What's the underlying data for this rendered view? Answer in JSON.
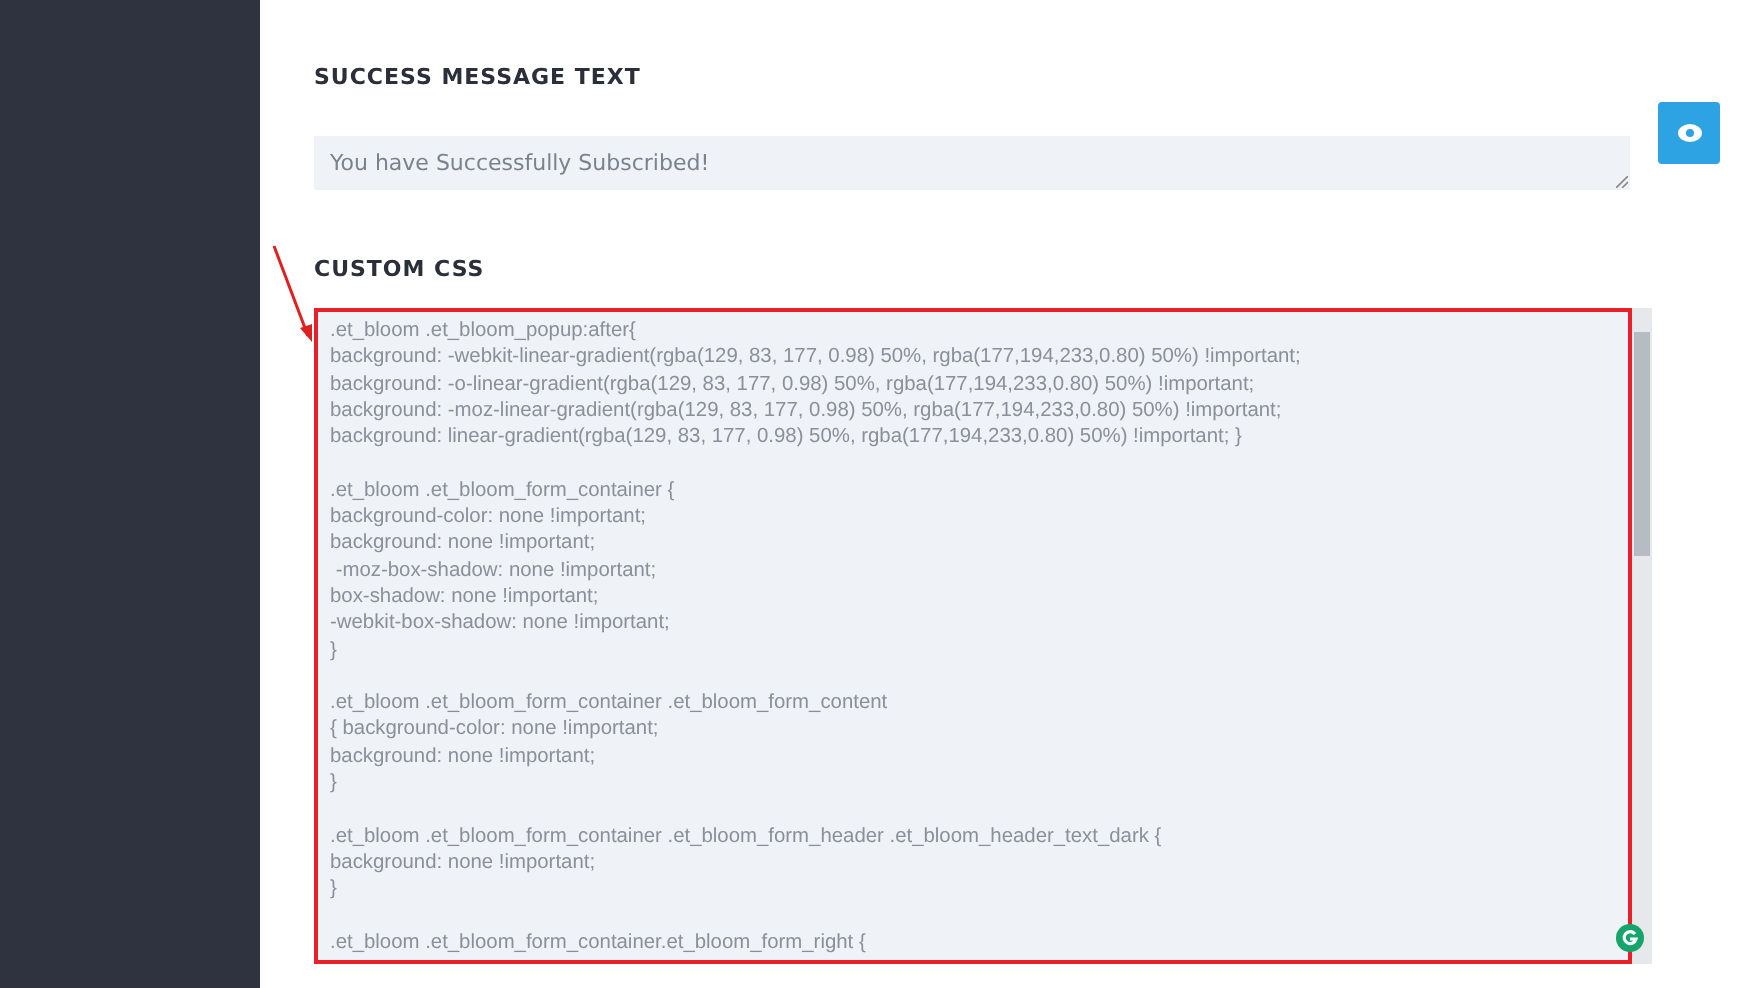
{
  "success_message": {
    "label": "SUCCESS MESSAGE TEXT",
    "value": "You have Successfully Subscribed!"
  },
  "custom_css": {
    "label": "CUSTOM CSS",
    "highlighted": true,
    "code_blocks": [
      [
        ".et_bloom .et_bloom_popup:after{",
        "background: -webkit-linear-gradient(rgba(129, 83, 177, 0.98) 50%, rgba(177,194,233,0.80) 50%) !important;",
        "background: -o-linear-gradient(rgba(129, 83, 177, 0.98) 50%, rgba(177,194,233,0.80) 50%) !important;",
        "background: -moz-linear-gradient(rgba(129, 83, 177, 0.98) 50%, rgba(177,194,233,0.80) 50%) !important;",
        "background: linear-gradient(rgba(129, 83, 177, 0.98) 50%, rgba(177,194,233,0.80) 50%) !important; }"
      ],
      [
        ".et_bloom .et_bloom_form_container {",
        "background-color: none !important;",
        "background: none !important;",
        " -moz-box-shadow: none !important;",
        "box-shadow: none !important;",
        "-webkit-box-shadow: none !important;",
        "}"
      ],
      [
        ".et_bloom .et_bloom_form_container .et_bloom_form_content",
        "{ background-color: none !important;",
        "background: none !important;",
        "}"
      ],
      [
        ".et_bloom .et_bloom_form_container .et_bloom_form_header .et_bloom_header_text_dark {",
        "background: none !important;",
        "}"
      ],
      [
        ".et_bloom .et_bloom_form_container.et_bloom_form_right {"
      ]
    ]
  }
}
